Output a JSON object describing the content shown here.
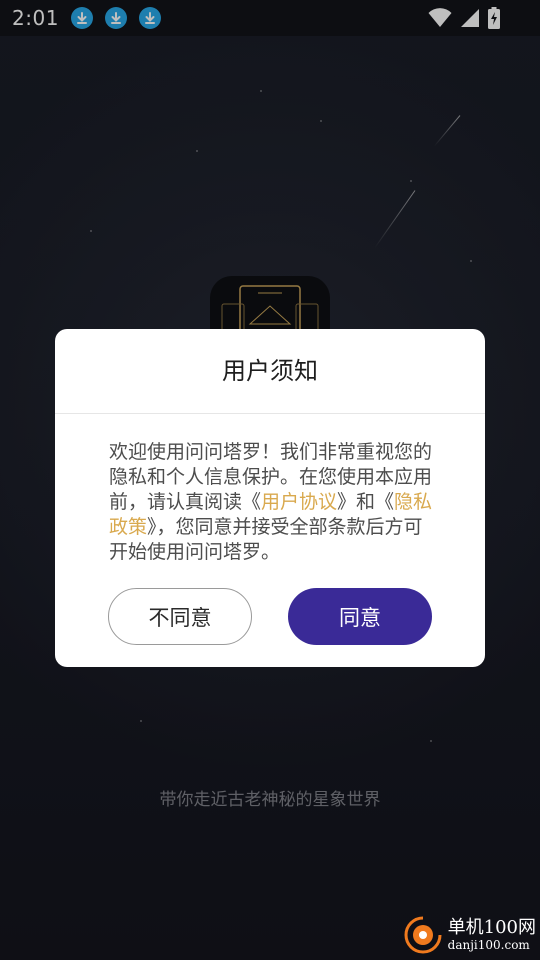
{
  "status_bar": {
    "time": "2:01",
    "notification_icons": [
      "download-icon",
      "download-icon",
      "download-icon"
    ],
    "system_icons": [
      "wifi-icon",
      "signal-icon",
      "battery-charging-icon"
    ]
  },
  "background": {
    "tagline": "带你走近古老神秘的星象世界"
  },
  "dialog": {
    "title": "用户须知",
    "body_part1": "欢迎使用问问塔罗！我们非常重视您的隐私和个人信息保护。在您使用本应用前，请认真阅读《",
    "user_agreement_link": "用户协议",
    "body_part2": "》和《",
    "privacy_policy_link": "隐私政策",
    "body_part3": "》，您同意并接受全部条款后方可开始使用问问塔罗。",
    "decline_label": "不同意",
    "accept_label": "同意"
  },
  "watermark": {
    "main": "单机100网",
    "sub": "danji100.com"
  },
  "colors": {
    "accent": "#3a2a97",
    "link": "#d9a94e",
    "download_badge": "#28a8e8",
    "watermark_orange": "#f07a1e"
  }
}
